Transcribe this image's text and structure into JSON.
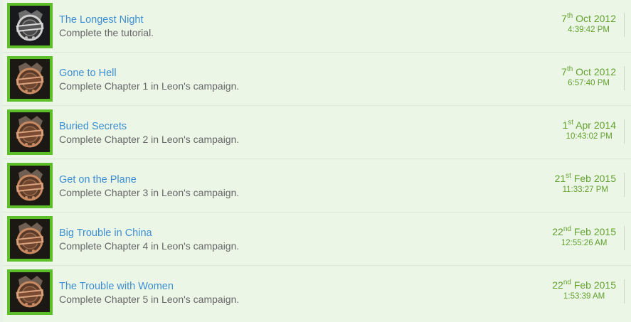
{
  "colors": {
    "accent": "#5cbf2a",
    "title": "#3d8ed1",
    "date": "#63a12e",
    "background": "#ebf6e7"
  },
  "achievements": [
    {
      "icon": "skull-emblem-relic-icon",
      "title": "The Longest Night",
      "description": "Complete the tutorial.",
      "day": "7",
      "suffix": "th",
      "month_year": "Oct 2012",
      "time": "4:39:42 PM"
    },
    {
      "icon": "skull-emblem-chapter-icon",
      "title": "Gone to Hell",
      "description": "Complete Chapter 1 in Leon's campaign.",
      "day": "7",
      "suffix": "th",
      "month_year": "Oct 2012",
      "time": "6:57:40 PM"
    },
    {
      "icon": "skull-emblem-chapter-icon",
      "title": "Buried Secrets",
      "description": "Complete Chapter 2 in Leon's campaign.",
      "day": "1",
      "suffix": "st",
      "month_year": "Apr 2014",
      "time": "10:43:02 PM"
    },
    {
      "icon": "skull-emblem-chapter-icon",
      "title": "Get on the Plane",
      "description": "Complete Chapter 3 in Leon's campaign.",
      "day": "21",
      "suffix": "st",
      "month_year": "Feb 2015",
      "time": "11:33:27 PM"
    },
    {
      "icon": "skull-emblem-chapter-icon",
      "title": "Big Trouble in China",
      "description": "Complete Chapter 4 in Leon's campaign.",
      "day": "22",
      "suffix": "nd",
      "month_year": "Feb 2015",
      "time": "12:55:26 AM"
    },
    {
      "icon": "skull-emblem-chapter-icon",
      "title": "The Trouble with Women",
      "description": "Complete Chapter 5 in Leon's campaign.",
      "day": "22",
      "suffix": "nd",
      "month_year": "Feb 2015",
      "time": "1:53:39 AM"
    }
  ]
}
